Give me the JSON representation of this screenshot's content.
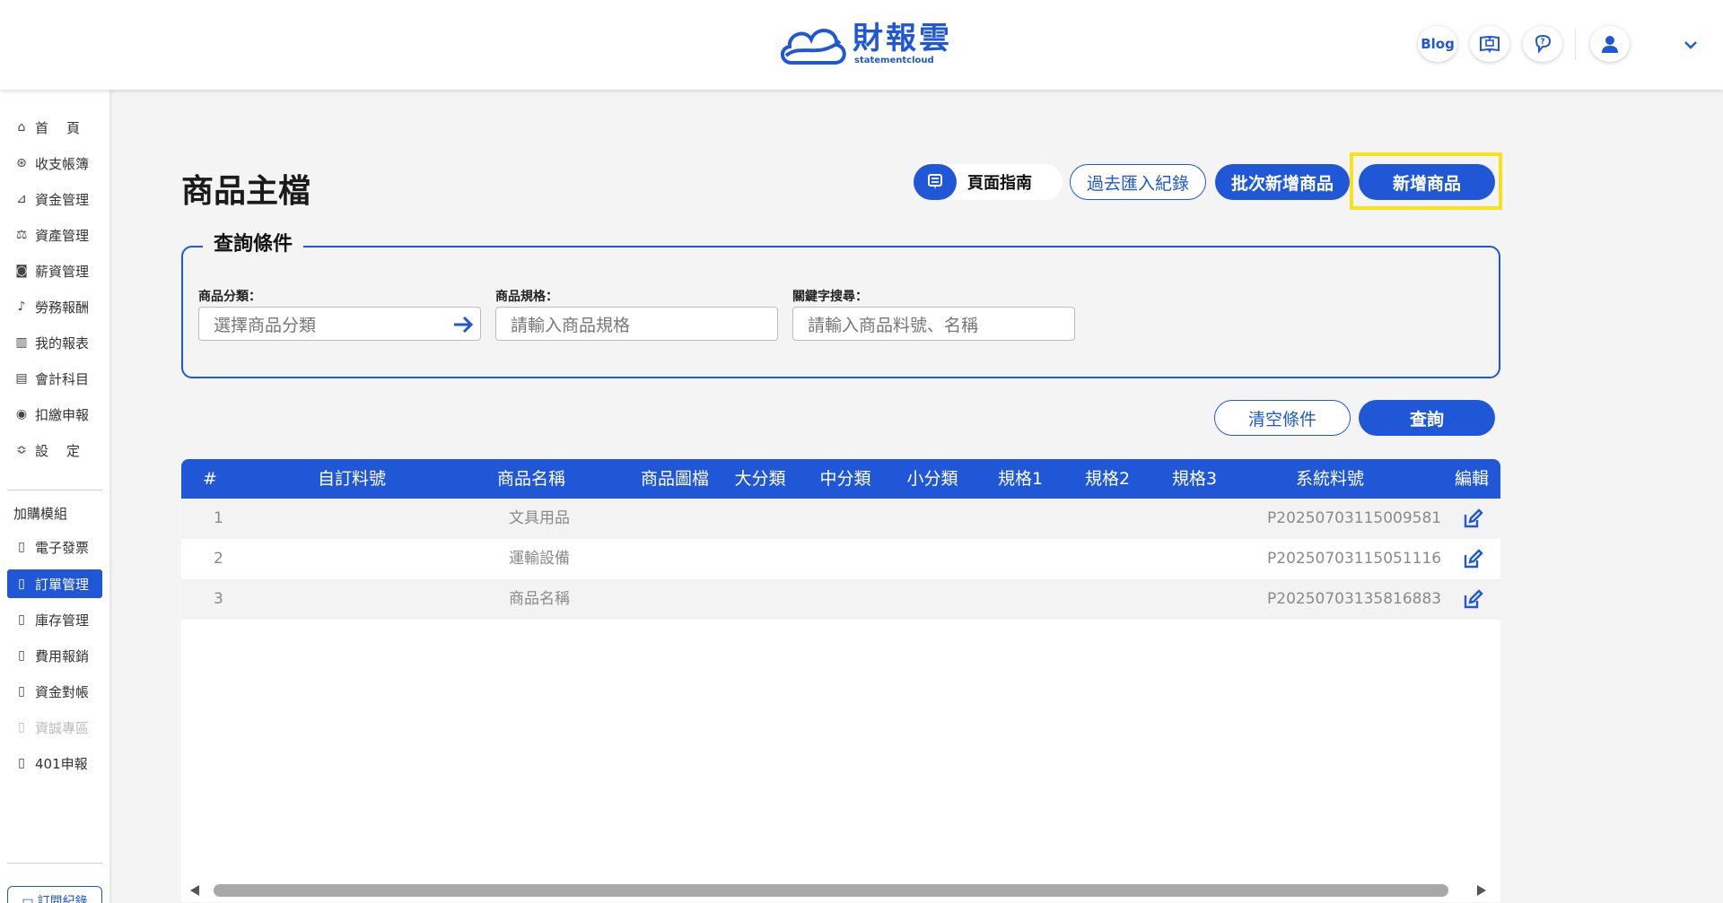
{
  "header": {
    "logo_cn": "財報雲",
    "logo_en": "statementcloud",
    "blog_label": "Blog",
    "icons": [
      "guide-book-icon",
      "help-chat-icon",
      "user-avatar-icon",
      "chevron-down-icon"
    ]
  },
  "sidebar": {
    "main_items": [
      {
        "label": "首頁",
        "icon": "home-icon"
      },
      {
        "label": "收支帳簿",
        "icon": "coin-icon"
      },
      {
        "label": "資金管理",
        "icon": "funds-icon"
      },
      {
        "label": "資產管理",
        "icon": "assets-icon"
      },
      {
        "label": "薪資管理",
        "icon": "salary-icon"
      },
      {
        "label": "勞務報酬",
        "icon": "labor-icon"
      },
      {
        "label": "我的報表",
        "icon": "report-icon"
      },
      {
        "label": "會計科目",
        "icon": "ledger-icon"
      },
      {
        "label": "扣繳申報",
        "icon": "tax-icon"
      },
      {
        "label": "設定",
        "icon": "settings-icon"
      }
    ],
    "group_label": "加購模組",
    "module_items": [
      {
        "label": "電子發票",
        "icon": "module-icon"
      },
      {
        "label": "訂單管理",
        "icon": "module-icon"
      },
      {
        "label": "庫存管理",
        "icon": "module-icon"
      },
      {
        "label": "費用報銷",
        "icon": "module-icon"
      },
      {
        "label": "資金對帳",
        "icon": "module-icon"
      },
      {
        "label": "資誠專區",
        "icon": "module-icon"
      },
      {
        "label": "401申報",
        "icon": "module-icon"
      }
    ],
    "subscription_label": "訂閱紀錄"
  },
  "page": {
    "title": "商品主檔",
    "guide_label": "頁面指南",
    "import_history_label": "過去匯入紀錄",
    "batch_add_label": "批次新增商品",
    "add_product_label": "新增商品"
  },
  "query": {
    "legend": "查詢條件",
    "category_label": "商品分類：",
    "category_placeholder": "選擇商品分類",
    "spec_label": "商品規格：",
    "spec_placeholder": "請輸入商品規格",
    "keyword_label": "關鍵字搜尋：",
    "keyword_placeholder": "請輸入商品料號、名稱",
    "clear_label": "清空條件",
    "search_label": "查詢"
  },
  "table": {
    "columns": [
      "#",
      "自訂料號",
      "商品名稱",
      "商品圖檔",
      "大分類",
      "中分類",
      "小分類",
      "規格1",
      "規格2",
      "規格3",
      "系統料號",
      "編輯"
    ],
    "rows": [
      {
        "index": "1",
        "name": "文具用品",
        "sys_id": "P20250703115009581"
      },
      {
        "index": "2",
        "name": "運輸設備",
        "sys_id": "P20250703115051116"
      },
      {
        "index": "3",
        "name": "商品名稱",
        "sys_id": "P20250703135816883"
      }
    ]
  },
  "colors": {
    "primary": "#1f57d6",
    "highlight": "#f8e11a",
    "background": "#f4f4f4"
  }
}
